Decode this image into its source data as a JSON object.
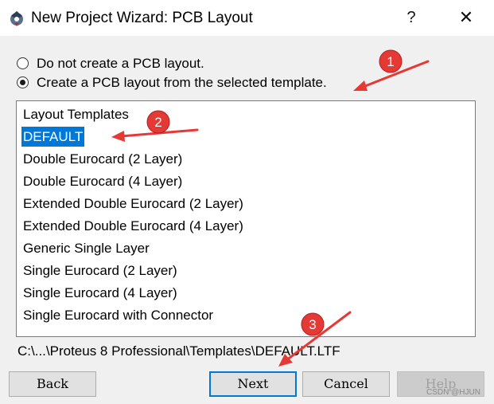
{
  "window": {
    "title": "New Project Wizard: PCB Layout",
    "help_glyph": "?",
    "close_glyph": "✕"
  },
  "options": [
    {
      "label": "Do not create a PCB layout.",
      "selected": false
    },
    {
      "label": "Create a PCB layout from the selected template.",
      "selected": true
    }
  ],
  "template_list": {
    "header": "Layout Templates",
    "items": [
      {
        "label": "DEFAULT",
        "selected": true
      },
      {
        "label": "Double Eurocard (2 Layer)",
        "selected": false
      },
      {
        "label": "Double Eurocard (4 Layer)",
        "selected": false
      },
      {
        "label": "Extended Double Eurocard (2 Layer)",
        "selected": false
      },
      {
        "label": "Extended Double Eurocard (4 Layer)",
        "selected": false
      },
      {
        "label": "Generic Single Layer",
        "selected": false
      },
      {
        "label": "Single Eurocard (2 Layer)",
        "selected": false
      },
      {
        "label": "Single Eurocard (4 Layer)",
        "selected": false
      },
      {
        "label": "Single Eurocard with Connector",
        "selected": false
      }
    ]
  },
  "selected_path": "C:\\...\\Proteus 8 Professional\\Templates\\DEFAULT.LTF",
  "buttons": {
    "back": "Back",
    "next": "Next",
    "cancel": "Cancel",
    "help": "Help"
  },
  "annotations": {
    "color": "#e53935",
    "badges": [
      "1",
      "2",
      "3"
    ]
  },
  "watermark": "CSDN @HJUN"
}
